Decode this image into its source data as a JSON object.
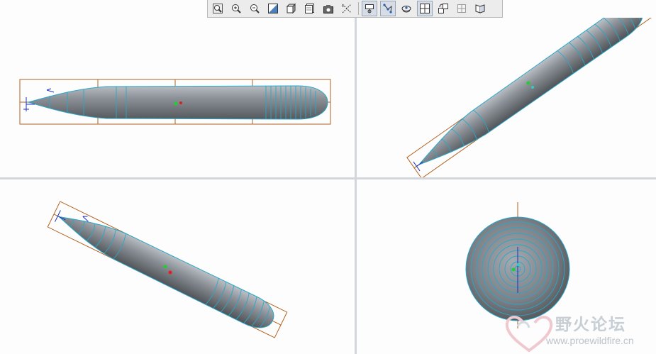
{
  "toolbar": {
    "buttons": [
      {
        "name": "zoom-fit",
        "icon": "zoom-fit-icon",
        "active": false
      },
      {
        "name": "zoom-in",
        "icon": "zoom-in-icon",
        "active": false
      },
      {
        "name": "zoom-out",
        "icon": "zoom-out-icon",
        "active": false
      },
      {
        "name": "repaint",
        "icon": "repaint-icon",
        "active": false
      },
      {
        "name": "shading",
        "icon": "shaded-cube-icon",
        "active": false
      },
      {
        "name": "saved-views",
        "icon": "saved-views-icon",
        "active": false
      },
      {
        "name": "orientation",
        "icon": "camera-icon",
        "active": false
      },
      {
        "name": "datum-axes",
        "icon": "datum-axes-icon",
        "active": false
      },
      {
        "name": "spin-center",
        "icon": "spin-center-icon",
        "active": true
      },
      {
        "name": "datum-points",
        "icon": "datum-points-icon",
        "active": true
      },
      {
        "name": "csys-display",
        "icon": "csys-icon",
        "active": false
      },
      {
        "name": "multi-view",
        "icon": "four-views-icon",
        "active": true
      },
      {
        "name": "swap-views",
        "icon": "swap-views-icon",
        "active": false
      },
      {
        "name": "layout-grid",
        "icon": "layout-grid-icon",
        "active": false
      },
      {
        "name": "view-manager",
        "icon": "view-manager-icon",
        "active": false
      }
    ]
  },
  "viewports": [
    {
      "name": "front-view"
    },
    {
      "name": "isometric-view-top-right"
    },
    {
      "name": "isometric-view-bottom-left"
    },
    {
      "name": "end-view"
    }
  ],
  "colors": {
    "body": "#8a9096",
    "section_lines": "#2aa7c9",
    "bounding_box": "#b4611f",
    "datum_axis": "#1f2fc0",
    "point_green": "#22cc33",
    "point_red": "#e02020",
    "background": "#fdfdfd"
  },
  "watermark": {
    "title": "野火论坛",
    "url": "www.proewildfire.cn"
  }
}
